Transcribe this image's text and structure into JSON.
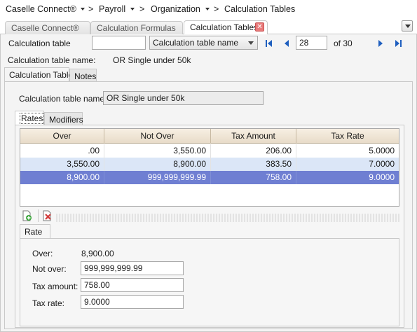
{
  "breadcrumb": {
    "items": [
      {
        "label": "Caselle Connect®"
      },
      {
        "label": "Payroll"
      },
      {
        "label": "Organization"
      },
      {
        "label": "Calculation Tables"
      }
    ],
    "separator": ">"
  },
  "doc_tabs": [
    {
      "label": "Caselle Connect®",
      "active": false
    },
    {
      "label": "Calculation Formulas",
      "active": false
    },
    {
      "label": "Calculation Tables",
      "active": true
    }
  ],
  "toolbar": {
    "table_label": "Calculation table",
    "table_value": "",
    "search_field": "Calculation table name",
    "record_number": "28",
    "record_total": "of 30"
  },
  "header": {
    "name_label": "Calculation table name:",
    "name_value": "OR Single under 50k"
  },
  "main_tabs": [
    {
      "label": "Calculation Table",
      "active": true
    },
    {
      "label": "Notes",
      "active": false
    }
  ],
  "form": {
    "name_label": "Calculation table name:",
    "name_value": "OR Single under 50k"
  },
  "sub_tabs": [
    {
      "label": "Rates",
      "active": true
    },
    {
      "label": "Modifiers",
      "active": false
    }
  ],
  "grid": {
    "columns": [
      "Over",
      "Not Over",
      "Tax Amount",
      "Tax Rate"
    ],
    "rows": [
      [
        ".00",
        "3,550.00",
        "206.00",
        "5.0000"
      ],
      [
        "3,550.00",
        "8,900.00",
        "383.50",
        "7.0000"
      ],
      [
        "8,900.00",
        "999,999,999.99",
        "758.00",
        "9.0000"
      ]
    ],
    "selected_row": 2
  },
  "detail": {
    "tab_label": "Rate",
    "over_label": "Over:",
    "over_value": "8,900.00",
    "not_over_label": "Not over:",
    "not_over_value": "999,999,999.99",
    "tax_amount_label": "Tax amount:",
    "tax_amount_value": "758.00",
    "tax_rate_label": "Tax rate:",
    "tax_rate_value": "9.0000"
  },
  "colors": {
    "selected_row": "#6f7fd2",
    "alt_row": "#dbe6f7",
    "nav_arrow": "#1f5fbf",
    "close_tab": "#e87a7a"
  }
}
